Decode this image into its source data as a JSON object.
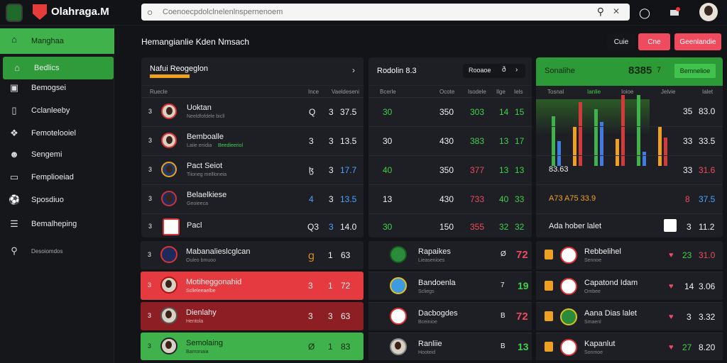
{
  "app": {
    "title": "Olahraga.M"
  },
  "search": {
    "placeholder": "Coenoecpdolclnelenlnspernenoem"
  },
  "sidebar": {
    "items": [
      {
        "label": "Manghaa",
        "icon": "home-icon"
      },
      {
        "label": "Bedlics",
        "icon": "home-icon"
      },
      {
        "label": "Bemogsei",
        "icon": "calendar-icon"
      },
      {
        "label": "Cclanleeby",
        "icon": "chat-icon"
      },
      {
        "label": "Femotelooiel",
        "icon": "stats-icon"
      },
      {
        "label": "Sengemi",
        "icon": "team-icon"
      },
      {
        "label": "Femplioeiad",
        "icon": "video-icon"
      },
      {
        "label": "Sposdiuo",
        "icon": "ball-icon"
      },
      {
        "label": "Bemalheping",
        "icon": "list-icon"
      },
      {
        "label": "Desoiomdos",
        "icon": "search-icon"
      }
    ]
  },
  "page": {
    "title": "Hemangianlie Kden Nmsach"
  },
  "buttons": {
    "b1": "Cuie",
    "b2": "Cne",
    "b3": "Geenlandie"
  },
  "panel_left": {
    "title": "Nafui Reogeglon",
    "cols": [
      "Ruecle",
      "Ince",
      "Vaeldeseni"
    ],
    "rows": [
      {
        "rank": "3",
        "name": "Uoktan",
        "sub": "Neeldfofdele bicll",
        "a": "Q",
        "b": "3",
        "c": "37.5"
      },
      {
        "rank": "3",
        "name": "Bemboalle",
        "sub": "Laiie enidia",
        "tag": "Beedieeriol",
        "a": "3",
        "b": "3",
        "c": "13.5"
      },
      {
        "rank": "3",
        "name": "Pact Seiot",
        "sub": "Tiioneg mellloneia",
        "a": "ɮ",
        "b": "3",
        "c": "17.7"
      },
      {
        "rank": "3",
        "name": "Belaelkiese",
        "sub": "Geoieeca",
        "a": "4",
        "b": "3",
        "c": "13.5"
      },
      {
        "rank": "3",
        "name": "Pacl",
        "sub": "",
        "a": "Q3",
        "b": "3",
        "c": "14.0"
      }
    ]
  },
  "panel_mid": {
    "title": "Rodolin 8.3",
    "select": "Rooaoe",
    "select2": "ð",
    "cols": [
      "Bcerle",
      "Ocote",
      "Isodele",
      "Ilge",
      "Iels"
    ],
    "rows": [
      {
        "a": "30",
        "b": "350",
        "c": "303",
        "d": "14",
        "e": "15"
      },
      {
        "a": "30",
        "b": "430",
        "c": "383",
        "d": "13",
        "e": "17"
      },
      {
        "a": "40",
        "b": "350",
        "c": "377",
        "d": "13",
        "e": "13"
      },
      {
        "a": "13",
        "b": "430",
        "c": "733",
        "d": "40",
        "e": "33"
      },
      {
        "a": "30",
        "b": "150",
        "c": "355",
        "d": "32",
        "e": "32"
      }
    ]
  },
  "panel_right": {
    "title": "Sonalihe",
    "score": "8385",
    "marker": "7",
    "button": "Bemnelioe",
    "cols": [
      "Tosnal",
      "Ianlie",
      "Ioioe",
      "Jelvie",
      "Ialet"
    ],
    "rows": [
      {
        "label": "",
        "a": "35",
        "b": "83.0"
      },
      {
        "label": "",
        "a": "33",
        "b": "33.5"
      },
      {
        "label": "83.63",
        "a": "33",
        "b": "31.6"
      },
      {
        "label": "A73 A75 33.9",
        "a": "8",
        "b": "37.5"
      },
      {
        "label": "Ada hober lalet",
        "a": "3",
        "b": "11.2"
      }
    ]
  },
  "chart_data": {
    "type": "bar",
    "series": [
      {
        "values": [
          70,
          55,
          80,
          38,
          100,
          55
        ]
      },
      {
        "values": [
          35,
          90,
          62,
          100,
          20,
          40
        ]
      }
    ]
  },
  "list_left": [
    {
      "rank": "3",
      "name": "Mabanalieslcglcan",
      "sub": "Ouleo bmuoo",
      "a": "Ɡ",
      "b": "1",
      "c": "63"
    },
    {
      "rank": "3",
      "name": "Motiheggonahid",
      "sub": "Sclleleeaelbe",
      "a": "3",
      "b": "1",
      "c": "72"
    },
    {
      "rank": "3",
      "name": "Dienlahy",
      "sub": "Hentola",
      "a": "3",
      "b": "3",
      "c": "63"
    },
    {
      "rank": "3",
      "name": "Semolaing",
      "sub": "Bamonaia",
      "a": "Ø",
      "b": "1",
      "c": "83"
    }
  ],
  "list_mid": [
    {
      "name": "Rapaikes",
      "sub": "Lieasenioes",
      "a": "Ø",
      "b": "72"
    },
    {
      "name": "Bandoenla",
      "sub": "Scliegs",
      "a": "7",
      "b": "19"
    },
    {
      "name": "Dacbogdes",
      "sub": "Bceinioe",
      "a": "B",
      "b": "72"
    },
    {
      "name": "Ranliie",
      "sub": "Hooteid",
      "a": "B",
      "b": "13"
    }
  ],
  "list_right": [
    {
      "name": "Rebbelihel",
      "sub": "Sennoe",
      "a": "23",
      "b": "31.0"
    },
    {
      "name": "Capatond Idam",
      "sub": "Ombee",
      "a": "14",
      "b": "3.06"
    },
    {
      "name": "Aana Dias lalet",
      "sub": "Smaenl",
      "a": "3",
      "b": "3.32"
    },
    {
      "name": "Kapanlut",
      "sub": "Sonmoe",
      "a": "27",
      "b": "8.20"
    }
  ]
}
